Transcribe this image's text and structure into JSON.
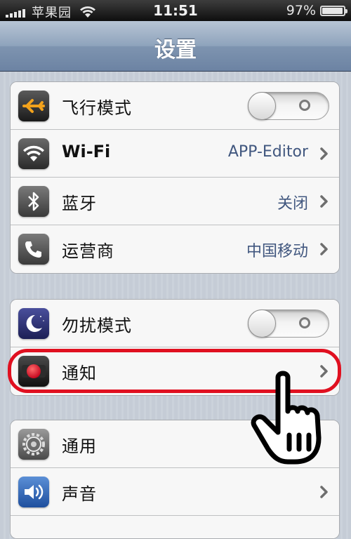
{
  "status_bar": {
    "carrier": "苹果园",
    "time": "11:51",
    "battery": "97%",
    "battery_level": 0.97
  },
  "nav": {
    "title": "设置"
  },
  "groups": [
    {
      "rows": [
        {
          "label": "飞行模式",
          "icon": "airplane-icon",
          "control": "toggle",
          "on": false
        },
        {
          "label": "Wi-Fi",
          "icon": "wifi-icon",
          "value": "APP-Editor"
        },
        {
          "label": "蓝牙",
          "icon": "bluetooth-icon",
          "value": "关闭"
        },
        {
          "label": "运营商",
          "icon": "phone-icon",
          "value": "中国移动"
        }
      ]
    },
    {
      "rows": [
        {
          "label": "勿扰模式",
          "icon": "moon-icon",
          "control": "toggle",
          "on": false
        },
        {
          "label": "通知",
          "icon": "notification-icon",
          "highlighted": true
        }
      ]
    },
    {
      "rows": [
        {
          "label": "通用",
          "icon": "gear-icon"
        },
        {
          "label": "声音",
          "icon": "speaker-icon"
        }
      ]
    }
  ],
  "colors": {
    "value_text": "#41577f",
    "highlight": "#e01020"
  }
}
